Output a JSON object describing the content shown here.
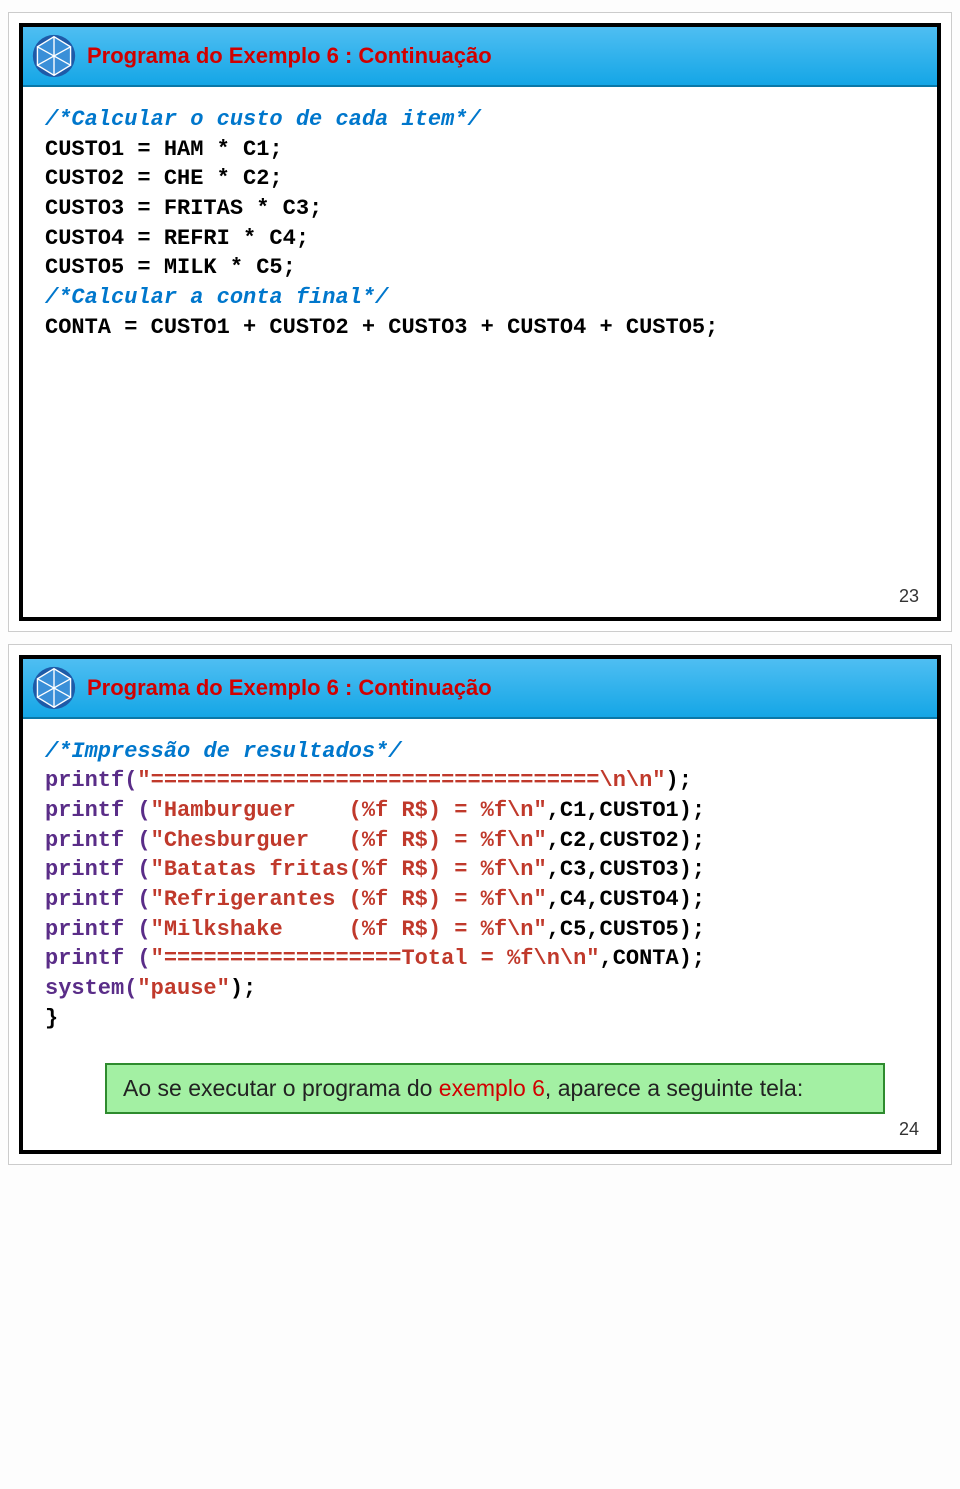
{
  "slide23": {
    "title": "Programa do Exemplo 6 : Continuação",
    "pagenum": "23",
    "code": {
      "c1": "/*Calcular o custo de cada item*/",
      "l1": "CUSTO1 = HAM * C1;",
      "l2": "CUSTO2 = CHE * C2;",
      "l3": "CUSTO3 = FRITAS * C3;",
      "l4": "CUSTO4 = REFRI * C4;",
      "l5": "CUSTO5 = MILK * C5;",
      "c2": "/*Calcular a conta final*/",
      "l6": "CONTA = CUSTO1 + CUSTO2 + CUSTO3 + CUSTO4 + CUSTO5;"
    }
  },
  "slide24": {
    "title": "Programa do Exemplo 6 : Continuação",
    "pagenum": "24",
    "code": {
      "c1": "/*Impressão de resultados*/",
      "p1a": "printf(",
      "p1b": "\"==================================\\n\\n\"",
      "p1c": ");",
      "p2a": "printf (",
      "p2b": "\"Hamburguer    (%f R$) = %f\\n\"",
      "p2c": ",C1,CUSTO1);",
      "p3a": "printf (",
      "p3b": "\"Chesburguer   (%f R$) = %f\\n\"",
      "p3c": ",C2,CUSTO2);",
      "p4a": "printf (",
      "p4b": "\"Batatas fritas(%f R$) = %f\\n\"",
      "p4c": ",C3,CUSTO3);",
      "p5a": "printf (",
      "p5b": "\"Refrigerantes (%f R$) = %f\\n\"",
      "p5c": ",C4,CUSTO4);",
      "p6a": "printf (",
      "p6b": "\"Milkshake     (%f R$) = %f\\n\"",
      "p6c": ",C5,CUSTO5);",
      "p7a": "printf (",
      "p7b": "\"==================Total = %f\\n\\n\"",
      "p7c": ",CONTA);",
      "p8a": "system(",
      "p8b": "\"pause\"",
      "p8c": ");",
      "p9": "}"
    },
    "note_pre": "Ao se executar o programa do ",
    "note_hl": "exemplo 6",
    "note_post": ", aparece a seguinte tela:"
  }
}
